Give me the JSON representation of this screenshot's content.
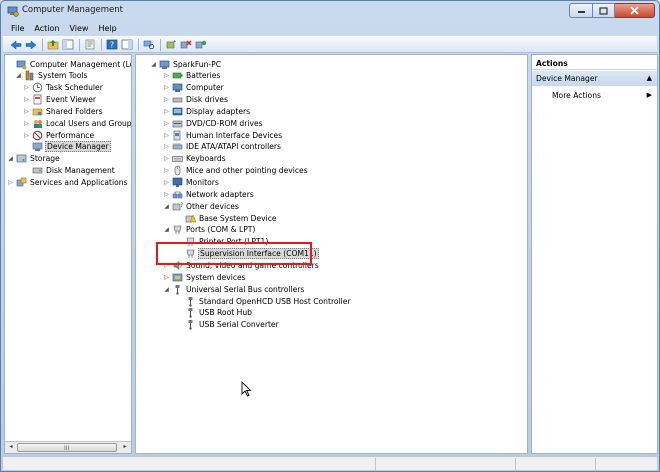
{
  "window": {
    "title": "Computer Management"
  },
  "menu": [
    "File",
    "Action",
    "View",
    "Help"
  ],
  "left_tree": [
    {
      "label": "Computer Management (Local",
      "depth": 0,
      "expander": "",
      "icon": "computer-mgmt-icon"
    },
    {
      "label": "System Tools",
      "depth": 1,
      "expander": "open",
      "icon": "tools-icon"
    },
    {
      "label": "Task Scheduler",
      "depth": 2,
      "expander": "closed",
      "icon": "clock-icon"
    },
    {
      "label": "Event Viewer",
      "depth": 2,
      "expander": "closed",
      "icon": "event-icon"
    },
    {
      "label": "Shared Folders",
      "depth": 2,
      "expander": "closed",
      "icon": "folder-icon"
    },
    {
      "label": "Local Users and Groups",
      "depth": 2,
      "expander": "closed",
      "icon": "users-icon"
    },
    {
      "label": "Performance",
      "depth": 2,
      "expander": "closed",
      "icon": "perf-icon"
    },
    {
      "label": "Device Manager",
      "depth": 2,
      "expander": "",
      "icon": "device-mgr-icon",
      "selected": true
    },
    {
      "label": "Storage",
      "depth": 0,
      "expander": "open",
      "icon": "storage-icon"
    },
    {
      "label": "Disk Management",
      "depth": 2,
      "expander": "",
      "icon": "disk-icon"
    },
    {
      "label": "Services and Applications",
      "depth": 0,
      "expander": "closed",
      "icon": "services-icon"
    }
  ],
  "device_tree": [
    {
      "label": "SparkFun-PC",
      "depth": 0,
      "expander": "open",
      "icon": "computer-icon"
    },
    {
      "label": "Batteries",
      "depth": 1,
      "expander": "closed",
      "icon": "battery-icon"
    },
    {
      "label": "Computer",
      "depth": 1,
      "expander": "closed",
      "icon": "pc-icon"
    },
    {
      "label": "Disk drives",
      "depth": 1,
      "expander": "closed",
      "icon": "disk-drive-icon"
    },
    {
      "label": "Display adapters",
      "depth": 1,
      "expander": "closed",
      "icon": "display-icon"
    },
    {
      "label": "DVD/CD-ROM drives",
      "depth": 1,
      "expander": "closed",
      "icon": "dvd-icon"
    },
    {
      "label": "Human Interface Devices",
      "depth": 1,
      "expander": "closed",
      "icon": "hid-icon"
    },
    {
      "label": "IDE ATA/ATAPI controllers",
      "depth": 1,
      "expander": "closed",
      "icon": "ide-icon"
    },
    {
      "label": "Keyboards",
      "depth": 1,
      "expander": "closed",
      "icon": "keyboard-icon"
    },
    {
      "label": "Mice and other pointing devices",
      "depth": 1,
      "expander": "closed",
      "icon": "mouse-icon"
    },
    {
      "label": "Monitors",
      "depth": 1,
      "expander": "closed",
      "icon": "monitor-icon"
    },
    {
      "label": "Network adapters",
      "depth": 1,
      "expander": "closed",
      "icon": "network-icon"
    },
    {
      "label": "Other devices",
      "depth": 1,
      "expander": "open",
      "icon": "other-devices-icon"
    },
    {
      "label": "Base System Device",
      "depth": 2,
      "expander": "",
      "icon": "warning-device-icon"
    },
    {
      "label": "Ports (COM & LPT)",
      "depth": 1,
      "expander": "open",
      "icon": "port-icon"
    },
    {
      "label": "Printer Port (LPT1)",
      "depth": 2,
      "expander": "",
      "icon": "port-icon"
    },
    {
      "label": "Supervision Interface (COM11)",
      "depth": 2,
      "expander": "",
      "icon": "port-icon",
      "selected": true
    },
    {
      "label": "Sound, video and game controllers",
      "depth": 1,
      "expander": "closed",
      "icon": "sound-icon"
    },
    {
      "label": "System devices",
      "depth": 1,
      "expander": "closed",
      "icon": "system-icon"
    },
    {
      "label": "Universal Serial Bus controllers",
      "depth": 1,
      "expander": "open",
      "icon": "usb-icon"
    },
    {
      "label": "Standard OpenHCD USB Host Controller",
      "depth": 2,
      "expander": "",
      "icon": "usb-icon"
    },
    {
      "label": "USB Root Hub",
      "depth": 2,
      "expander": "",
      "icon": "usb-icon"
    },
    {
      "label": "USB Serial Converter",
      "depth": 2,
      "expander": "",
      "icon": "usb-icon"
    }
  ],
  "actions": {
    "header": "Actions",
    "section": "Device Manager",
    "item": "More Actions"
  },
  "scroll": {
    "grip": "III"
  }
}
